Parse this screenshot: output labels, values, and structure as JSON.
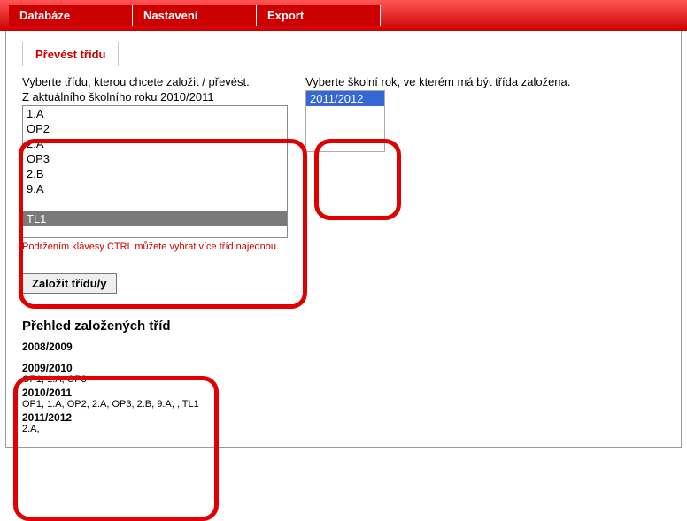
{
  "menu": {
    "items": [
      "Databáze",
      "Nastavení",
      "Export"
    ]
  },
  "tab_label": "Převést třídu",
  "left": {
    "prompt": "Vyberte třídu, kterou chcete založit / převést.",
    "subprompt": "Z aktuálního školního roku 2010/2011",
    "options": [
      "1.A",
      "OP2",
      "2.A",
      "OP3",
      "2.B",
      "9.A",
      "",
      "TL1"
    ],
    "selected": "TL1",
    "hint": "Podržením klávesy CTRL můžete vybrat více tříd najednou."
  },
  "right": {
    "prompt": "Vyberte školní rok, ve kterém má být třída založena.",
    "options": [
      "2011/2012"
    ],
    "selected": "2011/2012"
  },
  "button_label": "Založit třídu/y",
  "overview": {
    "title": "Přehled založených tříd",
    "years": [
      {
        "year": "2008/2009",
        "classes": ""
      },
      {
        "year": "2009/2010",
        "classes": "OP1, 1.A, OP3"
      },
      {
        "year": "2010/2011",
        "classes": "OP1, 1.A, OP2, 2.A, OP3, 2.B, 9.A, , TL1"
      },
      {
        "year": "2011/2012",
        "classes": "2.A,"
      }
    ]
  }
}
